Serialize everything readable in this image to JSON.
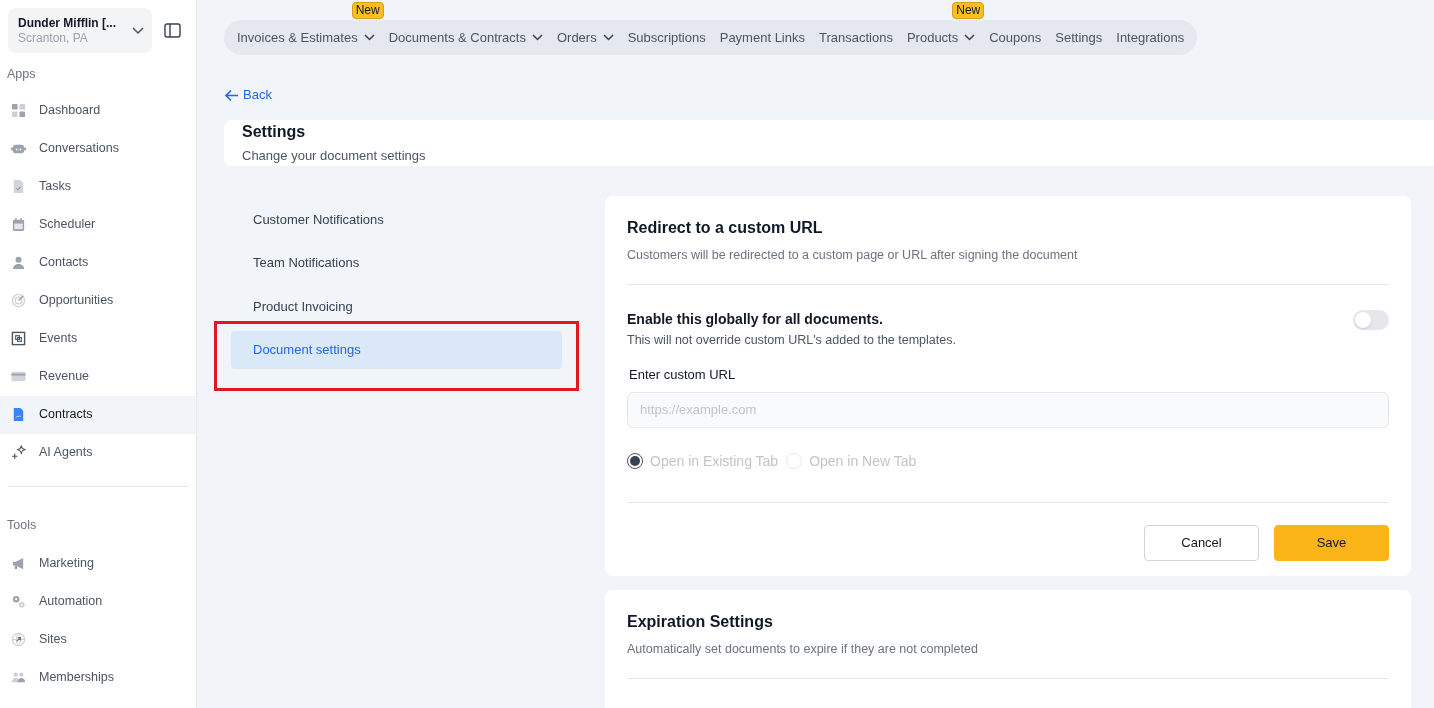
{
  "account": {
    "name": "Dunder Mifflin [...",
    "location": "Scranton, PA"
  },
  "sidebar": {
    "sections": [
      {
        "title": "Apps",
        "items": [
          {
            "label": "Dashboard",
            "selected": false
          },
          {
            "label": "Conversations",
            "selected": false
          },
          {
            "label": "Tasks",
            "selected": false
          },
          {
            "label": "Scheduler",
            "selected": false
          },
          {
            "label": "Contacts",
            "selected": false
          },
          {
            "label": "Opportunities",
            "selected": false
          },
          {
            "label": "Events",
            "selected": false
          },
          {
            "label": "Revenue",
            "selected": false
          },
          {
            "label": "Contracts",
            "selected": true
          },
          {
            "label": "AI Agents",
            "selected": false
          }
        ]
      },
      {
        "title": "Tools",
        "items": [
          {
            "label": "Marketing",
            "selected": false
          },
          {
            "label": "Automation",
            "selected": false
          },
          {
            "label": "Sites",
            "selected": false
          },
          {
            "label": "Memberships",
            "selected": false
          }
        ]
      }
    ]
  },
  "top_nav": [
    {
      "label": "Invoices & Estimates",
      "dropdown": true,
      "badge": "New"
    },
    {
      "label": "Documents & Contracts",
      "dropdown": true
    },
    {
      "label": "Orders",
      "dropdown": true
    },
    {
      "label": "Subscriptions",
      "dropdown": false
    },
    {
      "label": "Payment Links",
      "dropdown": false
    },
    {
      "label": "Transactions",
      "dropdown": false
    },
    {
      "label": "Products",
      "dropdown": true,
      "badge": "New"
    },
    {
      "label": "Coupons",
      "dropdown": false
    },
    {
      "label": "Settings",
      "dropdown": false
    },
    {
      "label": "Integrations",
      "dropdown": false
    }
  ],
  "back_link": "Back",
  "header": {
    "title": "Settings",
    "subtitle": "Change your document settings"
  },
  "settings_menu": [
    {
      "label": "Customer Notifications",
      "selected": false,
      "annotated": false
    },
    {
      "label": "Team Notifications",
      "selected": false,
      "annotated": false
    },
    {
      "label": "Product Invoicing",
      "selected": false,
      "annotated": false
    },
    {
      "label": "Document settings",
      "selected": true,
      "annotated": true
    }
  ],
  "redirect_card": {
    "title": "Redirect to a custom URL",
    "description": "Customers will be redirected to a custom page or URL after signing the document",
    "toggle": {
      "label": "Enable this globally for all documents.",
      "hint": "This will not override custom URL's added to the templates.",
      "on": false
    },
    "url_field": {
      "label": "Enter custom URL",
      "placeholder": "https://example.com"
    },
    "open_options": {
      "disabled": true,
      "options": [
        {
          "label": "Open in Existing Tab",
          "selected": true
        },
        {
          "label": "Open in New Tab",
          "selected": false
        }
      ]
    },
    "buttons": [
      {
        "label": "Cancel",
        "kind": "secondary"
      },
      {
        "label": "Save",
        "kind": "primary"
      }
    ]
  },
  "expiration_card": {
    "title": "Expiration Settings",
    "description": "Automatically set documents to expire if they are not completed"
  }
}
